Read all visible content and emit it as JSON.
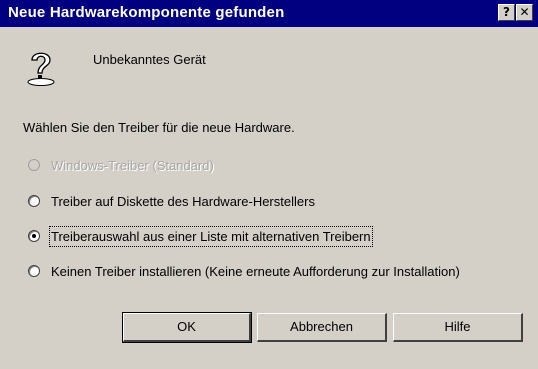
{
  "window": {
    "title": "Neue Hardwarekomponente gefunden",
    "help_button": "?",
    "close_button": "✕"
  },
  "device": {
    "icon": "question-mark-icon",
    "name": "Unbekanntes Gerät"
  },
  "prompt": "Wählen Sie den Treiber für die neue Hardware.",
  "options": [
    {
      "label": "Windows-Treiber (Standard)",
      "enabled": false,
      "selected": false
    },
    {
      "label": "Treiber auf Diskette des Hardware-Herstellers",
      "enabled": true,
      "selected": false
    },
    {
      "label": "Treiberauswahl aus einer Liste mit alternativen Treibern",
      "enabled": true,
      "selected": true
    },
    {
      "label": "Keinen Treiber installieren (Keine erneute Aufforderung zur Installation)",
      "enabled": true,
      "selected": false
    }
  ],
  "buttons": {
    "ok": "OK",
    "cancel": "Abbrechen",
    "help": "Hilfe"
  }
}
